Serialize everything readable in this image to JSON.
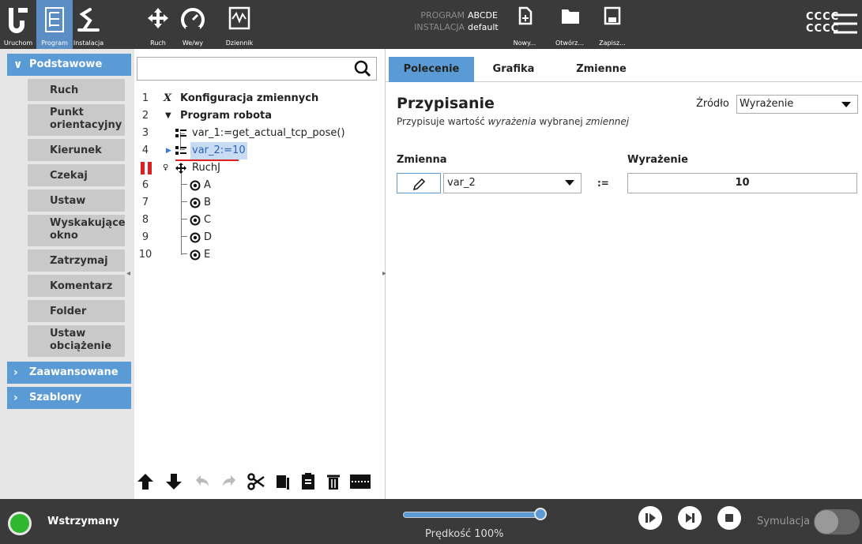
{
  "header": {
    "tabs": [
      {
        "label": "Uruchom",
        "icon": "ur-logo-icon"
      },
      {
        "label": "Program",
        "icon": "program-tree-icon",
        "active": true
      },
      {
        "label": "Instalacja",
        "icon": "robot-arm-icon"
      },
      {
        "label": "Ruch",
        "icon": "move-arrows-icon"
      },
      {
        "label": "We/wy",
        "icon": "io-gauge-icon"
      },
      {
        "label": "Dziennik",
        "icon": "log-chart-icon"
      }
    ],
    "program_label": "PROGRAM",
    "program_name": "ABCDE",
    "installation_label": "INSTALACJA",
    "installation_name": "default",
    "file_buttons": [
      {
        "label": "Nowy...",
        "icon": "new-file-icon"
      },
      {
        "label": "Otwórz...",
        "icon": "folder-icon"
      },
      {
        "label": "Zapisz...",
        "icon": "save-icon"
      }
    ],
    "user_line1": "CCCC",
    "user_line2": "CCCC",
    "menu_icon": "hamburger-menu-icon"
  },
  "left": {
    "category_basic": "Podstawowe",
    "commands": [
      {
        "label": "Ruch"
      },
      {
        "label": "Punkt orientacyjny"
      },
      {
        "label": "Kierunek"
      },
      {
        "label": "Czekaj"
      },
      {
        "label": "Ustaw"
      },
      {
        "label": "Wyskakujące okno"
      },
      {
        "label": "Zatrzymaj"
      },
      {
        "label": "Komentarz"
      },
      {
        "label": "Folder"
      },
      {
        "label": "Ustaw obciążenie"
      }
    ],
    "category_advanced": "Zaawansowane",
    "category_templates": "Szablony"
  },
  "tree": {
    "rows": [
      {
        "num": "1",
        "text": "Konfiguracja zmiennych"
      },
      {
        "num": "2",
        "text": "Program robota"
      },
      {
        "num": "3",
        "text": "var_1:=get_actual_tcp_pose()"
      },
      {
        "num": "4",
        "text": "var_2:=10"
      },
      {
        "num": "",
        "text": "RuchJ"
      },
      {
        "num": "6",
        "text": "A"
      },
      {
        "num": "7",
        "text": "B"
      },
      {
        "num": "8",
        "text": "C"
      },
      {
        "num": "9",
        "text": "D"
      },
      {
        "num": "10",
        "text": "E"
      }
    ],
    "toolbar_icons": [
      "move-up-icon",
      "move-down-icon",
      "undo-icon",
      "redo-icon",
      "cut-icon",
      "copy-icon",
      "paste-icon",
      "delete-icon",
      "suppress-icon"
    ]
  },
  "right": {
    "tabs": [
      "Polecenie",
      "Grafika",
      "Zmienne"
    ],
    "title": "Przypisanie",
    "desc_pre": "Przypisuje wartość ",
    "desc_em1": "wyrażenia",
    "desc_mid": " wybranej ",
    "desc_em2": "zmiennej",
    "source_label": "Źródło",
    "source_value": "Wyrażenie",
    "variable_label": "Zmienna",
    "expression_label": "Wyrażenie",
    "variable_value": "var_2",
    "assign_operator": ":=",
    "expression_value": "10"
  },
  "footer": {
    "status": "Wstrzymany",
    "speed_label": "Prędkość 100%",
    "speed_percent": 100,
    "simulation_label": "Symulacja",
    "simulation_on": false
  }
}
